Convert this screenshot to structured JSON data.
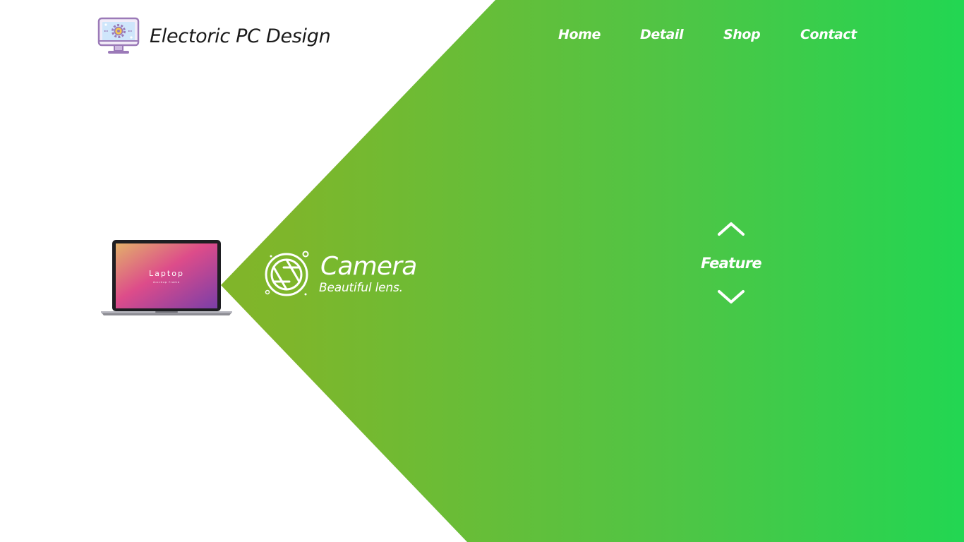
{
  "brand": {
    "title": "Electoric PC Design",
    "logo_icon": "monitor-gear-icon"
  },
  "nav": {
    "items": [
      {
        "label": "Home"
      },
      {
        "label": "Detail"
      },
      {
        "label": "Shop"
      },
      {
        "label": "Contact"
      }
    ]
  },
  "hero": {
    "laptop": {
      "screen_title": "Laptop",
      "screen_subtitle": "mockup frame"
    },
    "feature_item": {
      "icon": "camera-aperture-icon",
      "title": "Camera",
      "subtitle": "Beautiful lens."
    },
    "slider": {
      "label": "Feature",
      "prev_icon": "chevron-up-icon",
      "next_icon": "chevron-down-icon"
    }
  },
  "colors": {
    "gradient_start": "#8ab125",
    "gradient_end": "#22d652",
    "text_light": "#ffffff",
    "text_dark": "#1a1a1a",
    "logo_purple": "#9b7ab8"
  }
}
